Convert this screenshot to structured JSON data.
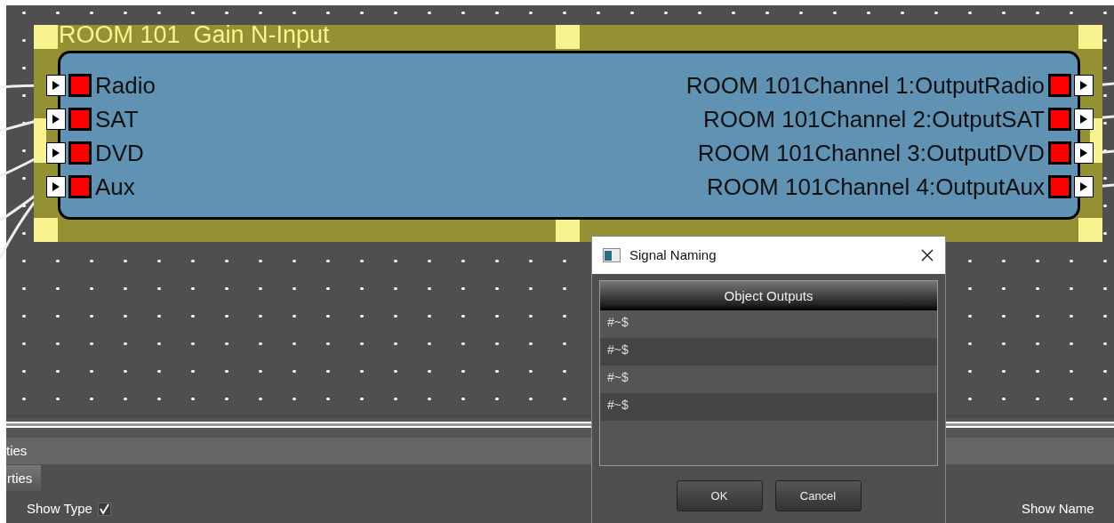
{
  "canvas": {
    "block": {
      "title": "ROOM 101  Gain N-Input",
      "inputs": [
        {
          "label": "Radio"
        },
        {
          "label": "SAT"
        },
        {
          "label": "DVD"
        },
        {
          "label": "Aux"
        }
      ],
      "outputs": [
        {
          "label": "ROOM 101Channel 1:OutputRadio"
        },
        {
          "label": "ROOM 101Channel 2:OutputSAT"
        },
        {
          "label": "ROOM 101Channel 3:OutputDVD"
        },
        {
          "label": "ROOM 101Channel 4:OutputAux"
        }
      ]
    }
  },
  "properties": {
    "header": "ties",
    "tab": "rties",
    "options": [
      {
        "label": "Show Type",
        "checked": true
      },
      {
        "label": "Show Name"
      }
    ]
  },
  "dialog": {
    "title": "Signal Naming",
    "table": {
      "columns": [
        "Object Outputs"
      ],
      "rows": [
        "#~$",
        "#~$",
        "#~$",
        "#~$"
      ]
    },
    "buttons": [
      "OK",
      "Cancel"
    ]
  }
}
